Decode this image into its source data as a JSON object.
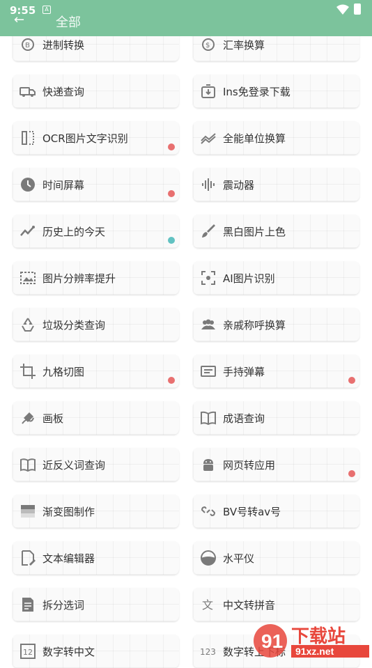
{
  "status_bar": {
    "time": "9:55",
    "sim_icon": "A"
  },
  "app_bar": {
    "title": "全部"
  },
  "colors": {
    "header": "#7cc39c",
    "dot_red": "#e87070",
    "dot_teal": "#62c2c2",
    "icon": "#7a7a7a"
  },
  "tools": [
    {
      "label": "进制转换",
      "icon": "binary-icon",
      "dot": null
    },
    {
      "label": "汇率换算",
      "icon": "currency-icon",
      "dot": null
    },
    {
      "label": "快递查询",
      "icon": "truck-icon",
      "dot": null
    },
    {
      "label": "Ins免登录下载",
      "icon": "download-box-icon",
      "dot": null
    },
    {
      "label": "OCR图片文字识别",
      "icon": "ocr-icon",
      "dot": "red"
    },
    {
      "label": "全能单位换算",
      "icon": "trend-icon",
      "dot": null
    },
    {
      "label": "时间屏幕",
      "icon": "clock-icon",
      "dot": "red"
    },
    {
      "label": "震动器",
      "icon": "waveform-icon",
      "dot": null
    },
    {
      "label": "历史上的今天",
      "icon": "line-chart-icon",
      "dot": "teal"
    },
    {
      "label": "黑白图片上色",
      "icon": "brush-icon",
      "dot": null
    },
    {
      "label": "图片分辨率提升",
      "icon": "image-upscale-icon",
      "dot": null
    },
    {
      "label": "AI图片识别",
      "icon": "scan-icon",
      "dot": null
    },
    {
      "label": "垃圾分类查询",
      "icon": "recycle-icon",
      "dot": null
    },
    {
      "label": "亲戚称呼换算",
      "icon": "people-icon",
      "dot": null
    },
    {
      "label": "九格切图",
      "icon": "crop-icon",
      "dot": "red"
    },
    {
      "label": "手持弹幕",
      "icon": "marquee-icon",
      "dot": "red"
    },
    {
      "label": "画板",
      "icon": "draw-icon",
      "dot": null
    },
    {
      "label": "成语查询",
      "icon": "book-icon",
      "dot": null
    },
    {
      "label": "近反义词查询",
      "icon": "book-open-icon",
      "dot": null
    },
    {
      "label": "网页转应用",
      "icon": "android-icon",
      "dot": "red"
    },
    {
      "label": "渐变图制作",
      "icon": "gradient-icon",
      "dot": null
    },
    {
      "label": "BV号转av号",
      "icon": "link-icon",
      "dot": null
    },
    {
      "label": "文本编辑器",
      "icon": "edit-doc-icon",
      "dot": null
    },
    {
      "label": "水平仪",
      "icon": "level-icon",
      "dot": null
    },
    {
      "label": "拆分选词",
      "icon": "doc-split-icon",
      "dot": null
    },
    {
      "label": "中文转拼音",
      "icon": "translate-icon",
      "dot": null
    },
    {
      "label": "数字转中文",
      "icon": "number-box-icon",
      "dot": null
    },
    {
      "label": "数字转上下标",
      "icon": "numeric-123-icon",
      "dot": null
    }
  ],
  "watermark": {
    "text": "下载站",
    "url": "91xz.net"
  }
}
